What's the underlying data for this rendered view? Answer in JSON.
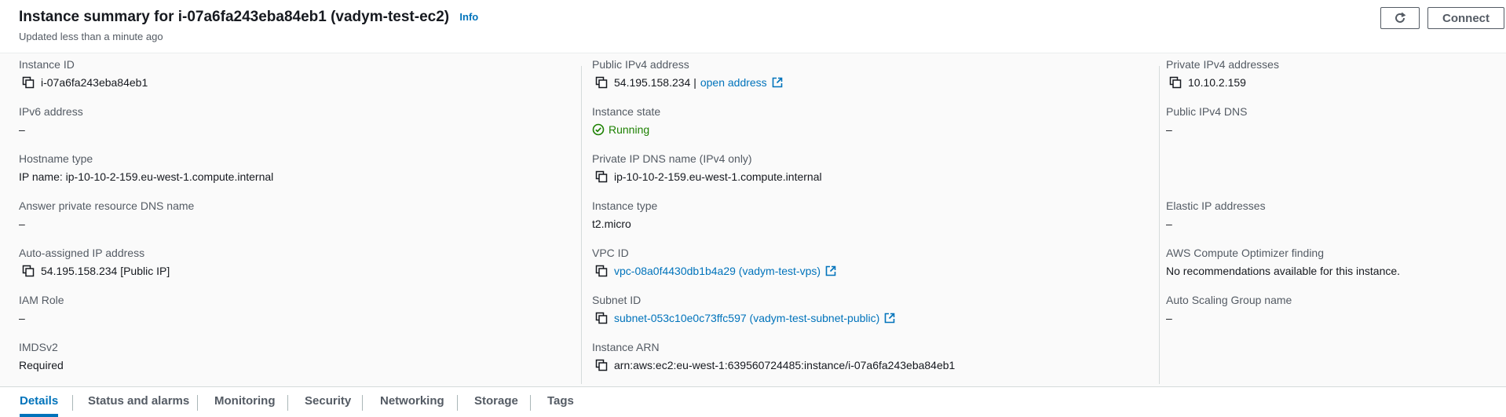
{
  "header": {
    "title": "Instance summary for i-07a6fa243eba84eb1 (vadym-test-ec2)",
    "info_link": "Info",
    "updated": "Updated less than a minute ago",
    "connect_label": "Connect",
    "refresh_icon": "refresh-icon"
  },
  "col1": {
    "instance_id_label": "Instance ID",
    "instance_id_value": "i-07a6fa243eba84eb1",
    "ipv6_label": "IPv6 address",
    "ipv6_value": "–",
    "hostname_type_label": "Hostname type",
    "hostname_type_value": "IP name: ip-10-10-2-159.eu-west-1.compute.internal",
    "answer_dns_label": "Answer private resource DNS name",
    "answer_dns_value": "–",
    "auto_ip_label": "Auto-assigned IP address",
    "auto_ip_value": "54.195.158.234 [Public IP]",
    "iam_role_label": "IAM Role",
    "iam_role_value": "–",
    "imdsv2_label": "IMDSv2",
    "imdsv2_value": "Required"
  },
  "col2": {
    "public_ipv4_label": "Public IPv4 address",
    "public_ipv4_value": "54.195.158.234 |",
    "open_address_link": "open address",
    "instance_state_label": "Instance state",
    "instance_state_value": "Running",
    "private_dns_label": "Private IP DNS name (IPv4 only)",
    "private_dns_value": "ip-10-10-2-159.eu-west-1.compute.internal",
    "instance_type_label": "Instance type",
    "instance_type_value": "t2.micro",
    "vpc_label": "VPC ID",
    "vpc_value": "vpc-08a0f4430db1b4a29 (vadym-test-vps)",
    "subnet_label": "Subnet ID",
    "subnet_value": "subnet-053c10e0c73ffc597 (vadym-test-subnet-public)",
    "arn_label": "Instance ARN",
    "arn_value": "arn:aws:ec2:eu-west-1:639560724485:instance/i-07a6fa243eba84eb1"
  },
  "col3": {
    "private_ipv4_label": "Private IPv4 addresses",
    "private_ipv4_value": "10.10.2.159",
    "public_dns_label": "Public IPv4 DNS",
    "public_dns_value": "–",
    "elastic_ip_label": "Elastic IP addresses",
    "elastic_ip_value": "–",
    "optimizer_label": "AWS Compute Optimizer finding",
    "optimizer_value": "No recommendations available for this instance.",
    "asg_label": "Auto Scaling Group name",
    "asg_value": "–"
  },
  "tabs": [
    {
      "label": "Details",
      "active": true
    },
    {
      "label": "Status and alarms",
      "active": false
    },
    {
      "label": "Monitoring",
      "active": false
    },
    {
      "label": "Security",
      "active": false
    },
    {
      "label": "Networking",
      "active": false
    },
    {
      "label": "Storage",
      "active": false
    },
    {
      "label": "Tags",
      "active": false
    }
  ],
  "colors": {
    "link": "#0073bb",
    "running": "#1d8102",
    "label": "#545b64",
    "text": "#16191f"
  }
}
